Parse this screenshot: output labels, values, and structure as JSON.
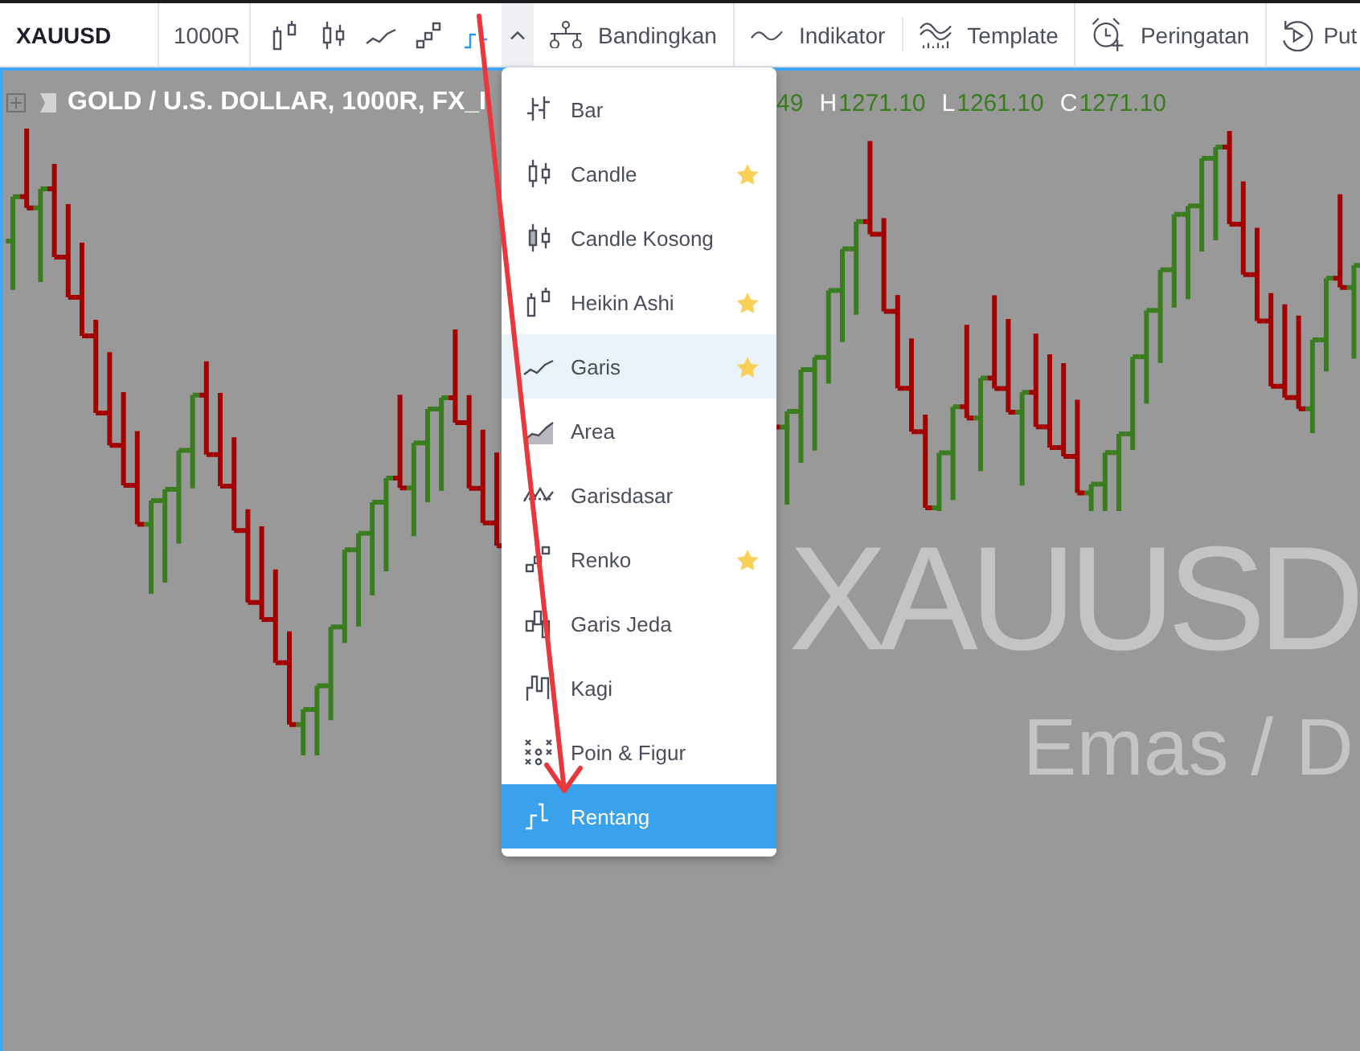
{
  "toolbar": {
    "symbol": "XAUUSD",
    "interval": "1000R",
    "chart_types": [
      {
        "kind": "heikin_ashi",
        "selected": false
      },
      {
        "kind": "candle",
        "selected": false
      },
      {
        "kind": "line",
        "selected": false
      },
      {
        "kind": "renko",
        "selected": false
      },
      {
        "kind": "range",
        "selected": true
      }
    ],
    "chart_type_dropdown": {
      "expanded": true
    },
    "buttons": [
      {
        "kind": "compare",
        "label": "Bandingkan"
      },
      {
        "kind": "indicators",
        "label": "Indikator"
      },
      {
        "kind": "templates",
        "label": "Template"
      },
      {
        "kind": "alerts",
        "label": "Peringatan"
      },
      {
        "kind": "replay",
        "label": "Put"
      }
    ]
  },
  "chart_type_menu": {
    "items": [
      {
        "kind": "bar",
        "label": "Bar",
        "favorite": false,
        "highlighted": false,
        "selected": false
      },
      {
        "kind": "candle",
        "label": "Candle",
        "favorite": true,
        "highlighted": false,
        "selected": false
      },
      {
        "kind": "hollow_candle",
        "label": "Candle Kosong",
        "favorite": false,
        "highlighted": false,
        "selected": false
      },
      {
        "kind": "heikin_ashi",
        "label": "Heikin Ashi",
        "favorite": true,
        "highlighted": false,
        "selected": false
      },
      {
        "kind": "line",
        "label": "Garis",
        "favorite": true,
        "highlighted": true,
        "selected": false
      },
      {
        "kind": "area",
        "label": "Area",
        "favorite": false,
        "highlighted": false,
        "selected": false
      },
      {
        "kind": "baseline",
        "label": "Garisdasar",
        "favorite": false,
        "highlighted": false,
        "selected": false
      },
      {
        "kind": "renko",
        "label": "Renko",
        "favorite": true,
        "highlighted": false,
        "selected": false
      },
      {
        "kind": "line_break",
        "label": "Garis Jeda",
        "favorite": false,
        "highlighted": false,
        "selected": false
      },
      {
        "kind": "kagi",
        "label": "Kagi",
        "favorite": false,
        "highlighted": false,
        "selected": false
      },
      {
        "kind": "point_figure",
        "label": "Poin & Figur",
        "favorite": false,
        "highlighted": false,
        "selected": false
      },
      {
        "kind": "range",
        "label": "Rentang",
        "favorite": false,
        "highlighted": false,
        "selected": true
      }
    ]
  },
  "chart": {
    "legend": {
      "title": "GOLD / U.S. DOLLAR, 1000R, FX_I",
      "values": [
        {
          "value": "49"
        },
        {
          "label": "H",
          "value": "1271.10"
        },
        {
          "label": "L",
          "value": "1261.10"
        },
        {
          "label": "C",
          "value": "1271.10"
        }
      ]
    },
    "watermark": {
      "symbol": "XAUUSD",
      "description": "Emas / D"
    }
  },
  "annotations": [
    {
      "kind": "arrow"
    }
  ]
}
